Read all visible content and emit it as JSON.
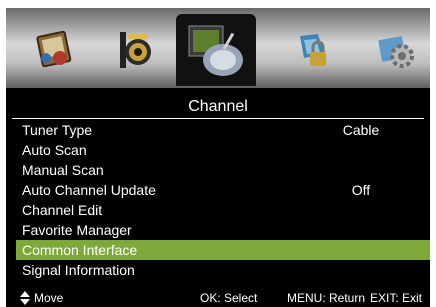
{
  "tabs": [
    {
      "icon": "picture-icon",
      "selected": false
    },
    {
      "icon": "sound-icon",
      "selected": false
    },
    {
      "icon": "channel-icon",
      "selected": true
    },
    {
      "icon": "lock-icon",
      "selected": false
    },
    {
      "icon": "setup-icon",
      "selected": false
    }
  ],
  "title": "Channel",
  "menu": {
    "tuner_type": {
      "label": "Tuner Type",
      "value": "Cable"
    },
    "auto_scan": {
      "label": "Auto Scan"
    },
    "manual_scan": {
      "label": "Manual Scan"
    },
    "auto_channel_update": {
      "label": "Auto Channel Update",
      "value": "Off"
    },
    "channel_edit": {
      "label": "Channel Edit"
    },
    "favorite_manager": {
      "label": "Favorite Manager"
    },
    "common_interface": {
      "label": "Common Interface",
      "highlighted": true
    },
    "signal_information": {
      "label": "Signal Information"
    }
  },
  "footer": {
    "move": "Move",
    "ok": "OK: Select",
    "menu": "MENU: Return",
    "exit": "EXIT: Exit"
  },
  "colors": {
    "highlight": "#7fa83b",
    "background": "#000000",
    "text": "#ffffff"
  }
}
